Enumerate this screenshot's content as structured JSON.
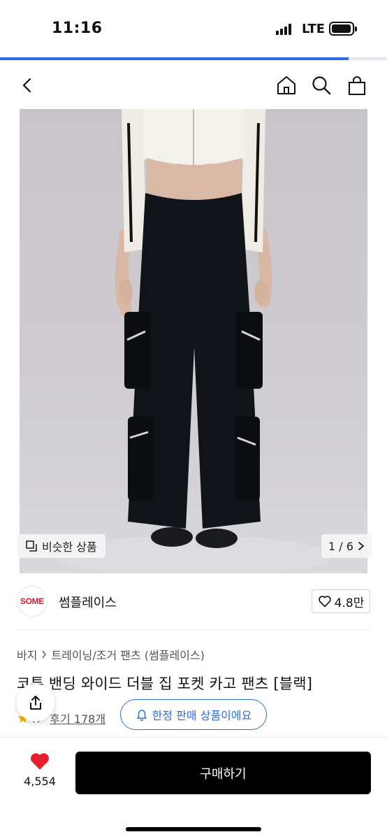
{
  "status": {
    "time": "11:16",
    "network": "LTE",
    "signal_bars": 4,
    "battery_level": 0.9
  },
  "page_load_progress": 0.9,
  "nav": {
    "back_icon": "chevron-left-icon",
    "home_icon": "home-icon",
    "search_icon": "search-icon",
    "cart_icon": "shopping-bag-icon"
  },
  "hero": {
    "similar_label": "비슷한 상품",
    "counter": "1 / 6"
  },
  "seller": {
    "logo_text": "SOME",
    "name": "썸플레이스",
    "rating": "4.8만"
  },
  "breadcrumb": {
    "category": "바지",
    "subcategory": "트레이닝/조거 팬츠 (썸플레이스)"
  },
  "product": {
    "title": "코튼 밴딩 와이드 더블 집 포켓 카고 팬츠 [블랙]",
    "review_score": ".7",
    "review_link": "후기 178개",
    "limited_badge": "한정 판매 상품이에요"
  },
  "bottom": {
    "like_count": "4,554",
    "buy_label": "구매하기"
  },
  "colors": {
    "accent": "#2d6cdf",
    "heart": "#e5202e",
    "button_bg": "#000000",
    "star": "#f4b400"
  }
}
